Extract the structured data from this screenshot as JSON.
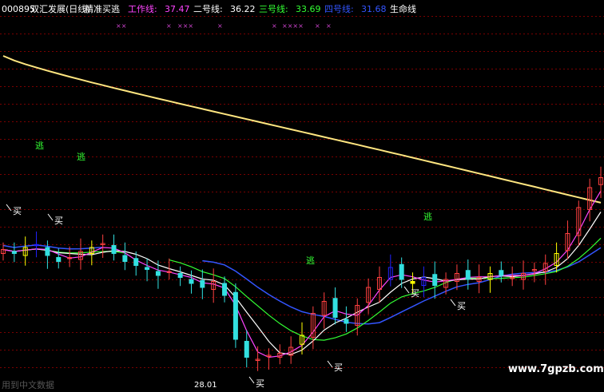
{
  "header": {
    "code": "000895",
    "name": "双汇发展(日线)",
    "indicator": "精准买逃",
    "fields": [
      {
        "label": "工作线:",
        "value": "37.47",
        "color": "#ff44ff"
      },
      {
        "label": "二号线:",
        "value": "36.22",
        "color": "#ffffff"
      },
      {
        "label": "三号线:",
        "value": "33.69",
        "color": "#33ff33"
      },
      {
        "label": "四号线:",
        "value": "31.68",
        "color": "#3355ff"
      },
      {
        "label": "生命线",
        "value": "",
        "color": "#ffffff"
      }
    ]
  },
  "markers": {
    "top_x_marks": [
      "××",
      "×",
      "×××",
      "×",
      "×",
      "××××",
      "×",
      "×"
    ],
    "buy_label": "买",
    "escape_label": "逃"
  },
  "colors": {
    "background": "#000000",
    "grid": "#7a0000",
    "up_candle": "#ff4040",
    "down_candle": "#33e0e0",
    "buy_bar": "#ffff00",
    "escape_bar": "#2222ff",
    "life_line": "#ffe680",
    "work_line": "#ff44ff",
    "line2": "#ffffff",
    "line3": "#33ff33",
    "line4": "#3355ff",
    "escape_text": "#33ff33",
    "buy_text": "#ffffff"
  },
  "chart_data": {
    "type": "candlestick",
    "low_label": "28.01",
    "bottom_text": "用到中文数据",
    "watermark": "www.7gpzb.com",
    "current_values": {
      "work_line": 37.47,
      "line2": 36.22,
      "line3": 33.69,
      "line4": 31.68
    },
    "close_approx": [
      33.8,
      33.6,
      33.9,
      34.0,
      33.5,
      33.2,
      33.4,
      33.7,
      33.9,
      34.1,
      33.6,
      33.2,
      33.0,
      32.8,
      32.5,
      32.7,
      32.4,
      32.1,
      31.9,
      32.2,
      31.5,
      29.3,
      28.4,
      28.3,
      28.5,
      28.6,
      28.9,
      29.5,
      30.6,
      31.2,
      30.4,
      30.1,
      31.0,
      31.9,
      32.4,
      32.9,
      32.3,
      32.1,
      32.4,
      32.0,
      32.3,
      32.6,
      32.3,
      32.4,
      32.6,
      32.5,
      32.4,
      32.6,
      32.8,
      33.1,
      33.6,
      34.6,
      35.9,
      36.9,
      37.4
    ]
  }
}
